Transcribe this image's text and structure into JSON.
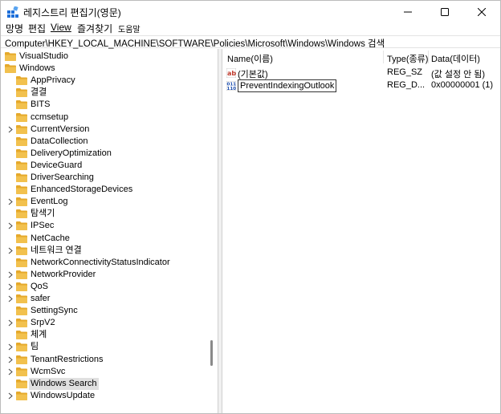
{
  "window": {
    "title": "레지스트리 편집기(영문)",
    "controls": {
      "minimize": "minimize",
      "maximize": "maximize",
      "close": "close"
    }
  },
  "menu": [
    {
      "label": "망명"
    },
    {
      "label": "편집"
    },
    {
      "label": "View"
    },
    {
      "label": "즐겨찾기"
    },
    {
      "label": "도움말"
    }
  ],
  "address": {
    "path": "Computer\\HKEY_LOCAL_MACHINE\\SOFTWARE\\Policies\\Microsoft\\Windows\\Windows 검색"
  },
  "tree": {
    "items": [
      {
        "label": "VisualStudio",
        "level": 0,
        "expandable": false
      },
      {
        "label": "Windows",
        "level": 0,
        "expandable": false
      },
      {
        "label": "AppPrivacy",
        "level": 1,
        "expandable": false
      },
      {
        "label": "결결",
        "level": 1,
        "expandable": false
      },
      {
        "label": "BITS",
        "level": 1,
        "expandable": false
      },
      {
        "label": "ccmsetup",
        "level": 1,
        "expandable": false
      },
      {
        "label": "CurrentVersion",
        "level": 1,
        "expandable": true
      },
      {
        "label": "DataCollection",
        "level": 1,
        "expandable": false
      },
      {
        "label": "DeliveryOptimization",
        "level": 1,
        "expandable": false
      },
      {
        "label": "DeviceGuard",
        "level": 1,
        "expandable": false
      },
      {
        "label": "DriverSearching",
        "level": 1,
        "expandable": false
      },
      {
        "label": "EnhancedStorageDevices",
        "level": 1,
        "expandable": false
      },
      {
        "label": "EventLog",
        "level": 1,
        "expandable": true
      },
      {
        "label": "탐색기",
        "level": 1,
        "expandable": false
      },
      {
        "label": "IPSec",
        "level": 1,
        "expandable": true
      },
      {
        "label": "NetCache",
        "level": 1,
        "expandable": false
      },
      {
        "label": "네트워크 연결",
        "level": 1,
        "expandable": true
      },
      {
        "label": "NetworkConnectivityStatusIndicator",
        "level": 1,
        "expandable": false
      },
      {
        "label": "NetworkProvider",
        "level": 1,
        "expandable": true
      },
      {
        "label": "QoS",
        "level": 1,
        "expandable": true
      },
      {
        "label": "safer",
        "level": 1,
        "expandable": true
      },
      {
        "label": "SettingSync",
        "level": 1,
        "expandable": false
      },
      {
        "label": "SrpV2",
        "level": 1,
        "expandable": true
      },
      {
        "label": "체계",
        "level": 1,
        "expandable": false
      },
      {
        "label": "팀",
        "level": 1,
        "expandable": true
      },
      {
        "label": "TenantRestrictions",
        "level": 1,
        "expandable": true
      },
      {
        "label": "WcmSvc",
        "level": 1,
        "expandable": true
      },
      {
        "label": "Windows Search",
        "level": 1,
        "expandable": false,
        "selected": true
      },
      {
        "label": "WindowsUpdate",
        "level": 1,
        "expandable": true
      }
    ]
  },
  "columns": {
    "name": "Name(이름)",
    "type": "Type(종류)",
    "data": "Data(데이터)"
  },
  "values": [
    {
      "icon": "string-value-icon",
      "name": "(기본값)",
      "type": "REG_SZ",
      "data": "(값 설정 안 됨)",
      "editing": false
    },
    {
      "icon": "dword-value-icon",
      "name": "PreventIndexingOutlook",
      "type": "REG_D...",
      "data": "0x00000001 (1)",
      "editing": true
    }
  ],
  "colors": {
    "folder": "#f2c14e",
    "folder_tab": "#e5a92b",
    "selection": "#e0e0e0",
    "app_icon": "#1e6fd9"
  }
}
